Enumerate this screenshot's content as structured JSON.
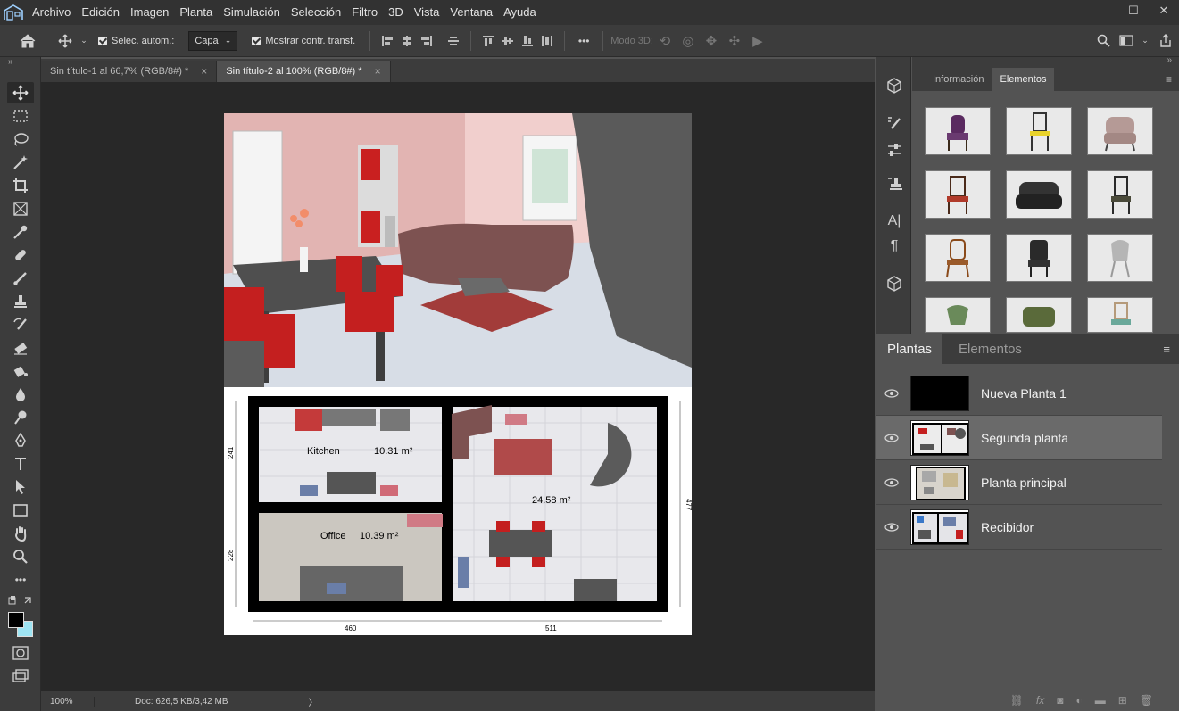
{
  "menu": {
    "items": [
      "Archivo",
      "Edición",
      "Imagen",
      "Planta",
      "Simulación",
      "Selección",
      "Filtro",
      "3D",
      "Vista",
      "Ventana",
      "Ayuda"
    ]
  },
  "window_controls": {
    "minimize": "–",
    "maximize": "☐",
    "close": "✕"
  },
  "options": {
    "auto_select_label": "Selec. autom.:",
    "auto_select_value": "Capa",
    "show_transform_label": "Mostrar contr. transf.",
    "mode3d_label": "Modo 3D:",
    "more": "•••"
  },
  "tabs": [
    {
      "label": "Sin título-1 al 66,7% (RGB/8#) *",
      "close": "×"
    },
    {
      "label": "Sin título-2 al 100% (RGB/8#) *",
      "close": "×"
    }
  ],
  "toolbar": {
    "collapse": "»"
  },
  "status": {
    "zoom": "100%",
    "doc": "Doc: 626,5 KB/3,42 MB",
    "arrow": "〉"
  },
  "floorplan": {
    "rooms": [
      {
        "name": "Kitchen",
        "area": "10.31 m²"
      },
      {
        "name": "Office",
        "area": "10.39 m²"
      },
      {
        "name": "",
        "area": "24.58 m²"
      }
    ],
    "dims": {
      "left_top": "241",
      "left_bottom": "228",
      "right": "477",
      "bottom_left": "460",
      "bottom_right": "511"
    }
  },
  "elements_panel": {
    "tabs": [
      "Información",
      "Elementos"
    ],
    "active_tab": "Elementos",
    "menu": "≡",
    "collapse": "»"
  },
  "layers_panel": {
    "tabs": [
      "Plantas",
      "Elementos"
    ],
    "active_tab": "Plantas",
    "menu": "≡",
    "layers": [
      {
        "name": "Nueva Planta 1",
        "selected": false
      },
      {
        "name": "Segunda planta",
        "selected": true
      },
      {
        "name": "Planta principal",
        "selected": false
      },
      {
        "name": "Recibidor",
        "selected": false
      }
    ],
    "footer_fx": "fx"
  },
  "colors": {
    "menubar": "#323232",
    "panel": "#3c3c3c",
    "canvas_bg": "#282828",
    "selected_layer": "#6a6a6a",
    "foreground_swatch": "#000000",
    "background_swatch": "#9ee4f3"
  }
}
